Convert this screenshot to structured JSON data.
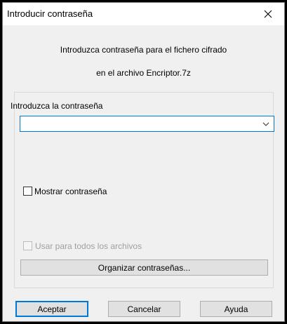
{
  "window": {
    "title": "Introducir contraseña",
    "close_icon": "close-icon"
  },
  "message": {
    "line1": "Introduzca contraseña para el fichero cifrado",
    "line2": "en el archivo Encriptor.7z"
  },
  "password": {
    "label": "Introduzca la contraseña",
    "value": "",
    "dropdown_icon": "chevron-down-icon"
  },
  "show_password": {
    "label": "Mostrar contraseña",
    "checked": false
  },
  "use_for_all": {
    "label": "Usar para todos los archivos",
    "checked": false,
    "enabled": false
  },
  "buttons": {
    "manage": "Organizar contraseñas...",
    "ok": "Aceptar",
    "cancel": "Cancelar",
    "help": "Ayuda"
  },
  "colors": {
    "focus_accent": "#0078d7",
    "dialog_bg": "#f0f0f0",
    "button_bg": "#e1e1e1"
  }
}
